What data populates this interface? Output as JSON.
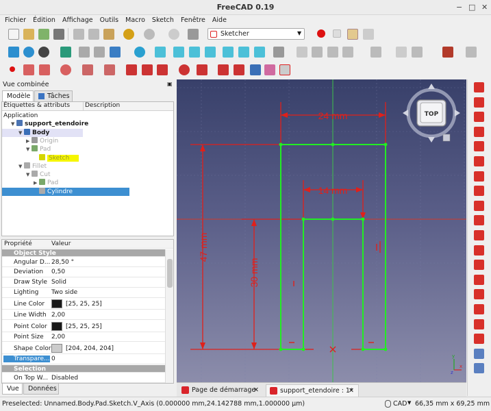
{
  "window": {
    "title": "FreeCAD 0.19"
  },
  "menu": [
    "Fichier",
    "Édition",
    "Affichage",
    "Outils",
    "Macro",
    "Sketch",
    "Fenêtre",
    "Aide"
  ],
  "workbench": {
    "selected": "Sketcher"
  },
  "combo": {
    "title": "Vue combinée",
    "tabs": [
      "Modèle",
      "Tâches"
    ],
    "tree_headers": [
      "Étiquettes & attributs",
      "Description"
    ],
    "tree": [
      {
        "label": "Application",
        "level": 0,
        "bold": false,
        "state": "normal"
      },
      {
        "label": "support_etendoire",
        "level": 1,
        "bold": true,
        "state": "normal"
      },
      {
        "label": "Body",
        "level": 2,
        "bold": true,
        "state": "body"
      },
      {
        "label": "Origin",
        "level": 3,
        "bold": false,
        "state": "dim"
      },
      {
        "label": "Pad",
        "level": 3,
        "bold": false,
        "state": "dim"
      },
      {
        "label": "Sketch",
        "level": 4,
        "bold": false,
        "state": "highlight"
      },
      {
        "label": "Fillet",
        "level": 2,
        "bold": false,
        "state": "dim"
      },
      {
        "label": "Cut",
        "level": 3,
        "bold": false,
        "state": "dim"
      },
      {
        "label": "Pad",
        "level": 4,
        "bold": false,
        "state": "dim"
      },
      {
        "label": "Cylindre",
        "level": 4,
        "bold": false,
        "state": "selected"
      }
    ],
    "prop_headers": [
      "Propriété",
      "Valeur"
    ],
    "properties": [
      {
        "type": "group",
        "name": "Object Style"
      },
      {
        "name": "Angular D...",
        "value": "28,50 °"
      },
      {
        "name": "Deviation",
        "value": "0,50"
      },
      {
        "name": "Draw Style",
        "value": "Solid"
      },
      {
        "name": "Lighting",
        "value": "Two side"
      },
      {
        "name": "Line Color",
        "value": "[25, 25, 25]",
        "swatch": "#191919"
      },
      {
        "name": "Line Width",
        "value": "2,00"
      },
      {
        "name": "Point Color",
        "value": "[25, 25, 25]",
        "swatch": "#191919"
      },
      {
        "name": "Point Size",
        "value": "2,00"
      },
      {
        "name": "Shape Color",
        "value": "[204, 204, 204]",
        "swatch": "#cccccc"
      },
      {
        "name": "Transpare...",
        "value": "0",
        "selected": true
      },
      {
        "type": "group",
        "name": "Selection"
      },
      {
        "name": "On Top W...",
        "value": "Disabled"
      }
    ],
    "bottom_tabs": [
      "Vue",
      "Données"
    ]
  },
  "view": {
    "navcube_face": "TOP",
    "dimensions": [
      "24 mm",
      "14 mm",
      "47 mm",
      "30 mm"
    ],
    "axis_labels": [
      "y",
      "x",
      "z"
    ]
  },
  "doc_tabs": [
    "Page de démarrage",
    "support_etendoire : 1*"
  ],
  "status": {
    "message": "Preselected: Unnamed.Body.Pad.Sketch.V_Axis (0.000000 mm,24.142788 mm,1.000000 µm)",
    "nav_style": "CAD",
    "dimensions": "66,35 mm x 69,25 mm"
  },
  "colors": {
    "accent": "#3d8fd1",
    "sketch_green": "#22ee22",
    "dim_red": "#e0201a"
  }
}
